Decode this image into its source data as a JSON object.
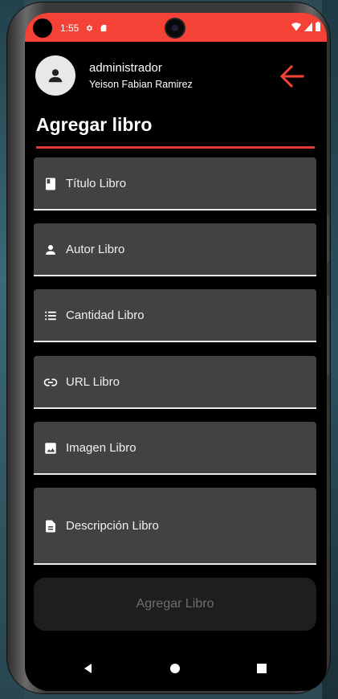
{
  "status_bar": {
    "time": "1:55",
    "color": "#f44336",
    "left_icons": [
      "settings-icon",
      "sim-card-icon"
    ],
    "right_icons": [
      "wifi-icon",
      "signal-icon",
      "battery-icon"
    ]
  },
  "header": {
    "role": "administrador",
    "username": "Yeison Fabian Ramirez",
    "avatar_icon": "person-icon",
    "back_icon": "arrow-left-icon",
    "back_color": "#f44336"
  },
  "page": {
    "title": "Agregar libro",
    "accent_color": "#e53935"
  },
  "form": {
    "fields": [
      {
        "label": "Título Libro",
        "icon": "book-icon",
        "value": ""
      },
      {
        "label": "Autor Libro",
        "icon": "person-icon",
        "value": ""
      },
      {
        "label": "Cantidad Libro",
        "icon": "list-icon",
        "value": ""
      },
      {
        "label": "URL Libro",
        "icon": "link-icon",
        "value": ""
      },
      {
        "label": "Imagen Libro",
        "icon": "image-icon",
        "value": ""
      },
      {
        "label": "Descripción Libro",
        "icon": "description-icon",
        "value": ""
      }
    ],
    "submit_label": "Agregar Libro"
  },
  "nav": {
    "icons": [
      "back-triangle-icon",
      "home-circle-icon",
      "recents-square-icon"
    ]
  }
}
